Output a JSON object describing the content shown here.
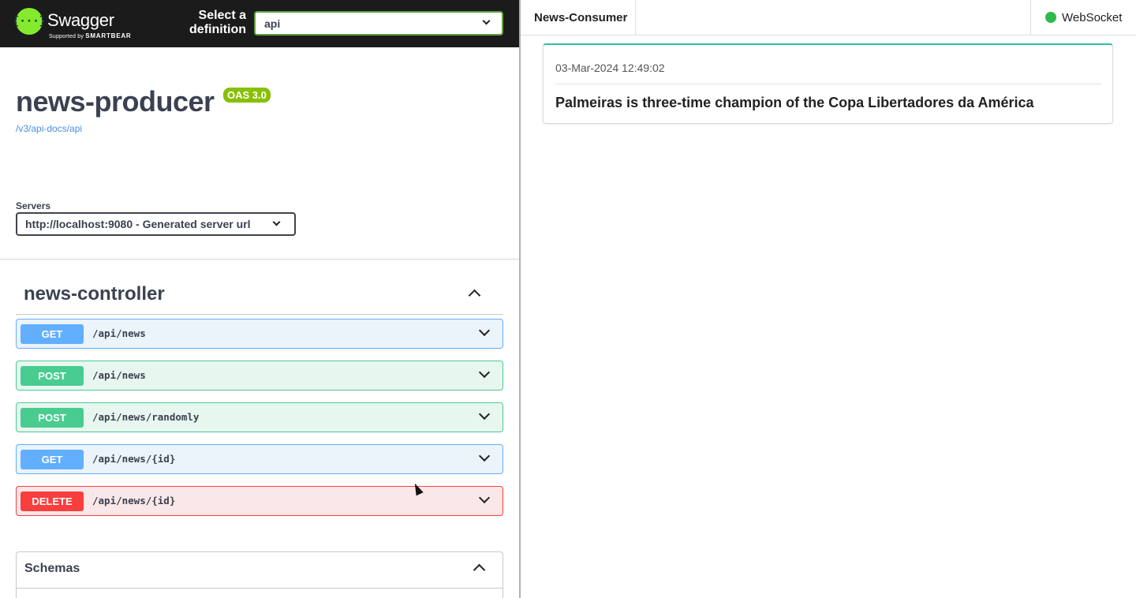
{
  "swagger": {
    "logo": {
      "word": "Swagger",
      "sub_prefix": "Supported by",
      "sub_brand": "SMARTBEAR",
      "icon_glyph": "{···}"
    },
    "definition": {
      "label_line1": "Select a",
      "label_line2": "definition",
      "selected": "api"
    },
    "info": {
      "title": "news-producer",
      "version_badge": "OAS 3.0",
      "doc_link": "/v3/api-docs/api"
    },
    "servers": {
      "label": "Servers",
      "selected": "http://localhost:9080 - Generated server url"
    },
    "tag": {
      "name": "news-controller"
    },
    "operations": [
      {
        "method": "GET",
        "path": "/api/news",
        "color": "#61affe"
      },
      {
        "method": "POST",
        "path": "/api/news",
        "color": "#49cc90"
      },
      {
        "method": "POST",
        "path": "/api/news/randomly",
        "color": "#49cc90"
      },
      {
        "method": "GET",
        "path": "/api/news/{id}",
        "color": "#61affe"
      },
      {
        "method": "DELETE",
        "path": "/api/news/{id}",
        "color": "#f93e3e"
      }
    ],
    "schemas": {
      "title": "Schemas"
    }
  },
  "consumer": {
    "brand": "News-Consumer",
    "status": {
      "label": "WebSocket",
      "color": "#2fb94b"
    },
    "news": [
      {
        "date": "03-Mar-2024 12:49:02",
        "headline": "Palmeiras is three-time champion of the Copa Libertadores da América"
      }
    ]
  }
}
